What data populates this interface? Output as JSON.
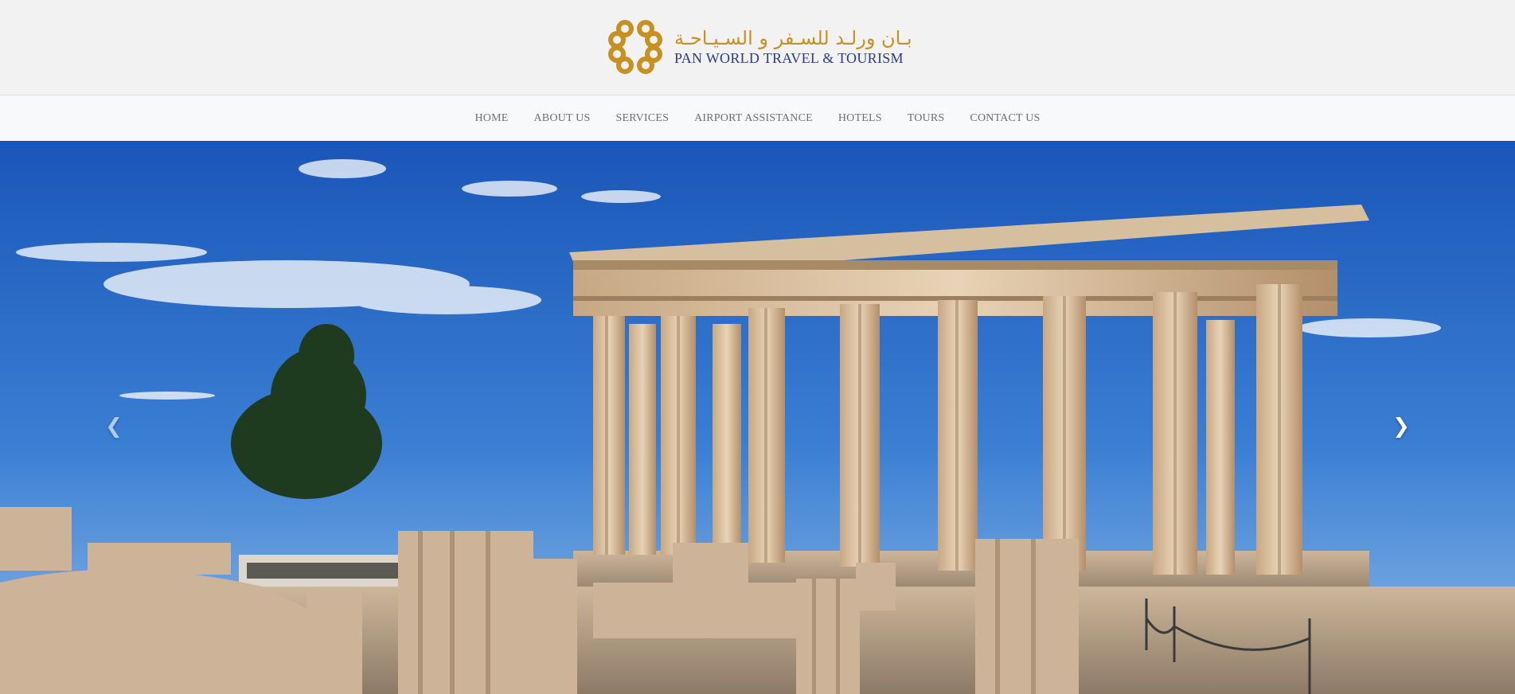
{
  "brand": {
    "arabic_name": "بـان ورلـد للسـفر و السـيـاحـة",
    "english_name": "PAN WORLD TRAVEL & TOURISM",
    "gold": "#c8901f",
    "navy": "#2c3a8c"
  },
  "nav": {
    "items": [
      {
        "label": "HOME"
      },
      {
        "label": "ABOUT US"
      },
      {
        "label": "SERVICES"
      },
      {
        "label": "AIRPORT ASSISTANCE"
      },
      {
        "label": "HOTELS"
      },
      {
        "label": "TOURS"
      },
      {
        "label": "CONTACT US"
      }
    ]
  },
  "carousel": {
    "prev_icon": "chevron-left-icon",
    "next_icon": "chevron-right-icon",
    "prev_glyph": "❮",
    "next_glyph": "❯"
  }
}
